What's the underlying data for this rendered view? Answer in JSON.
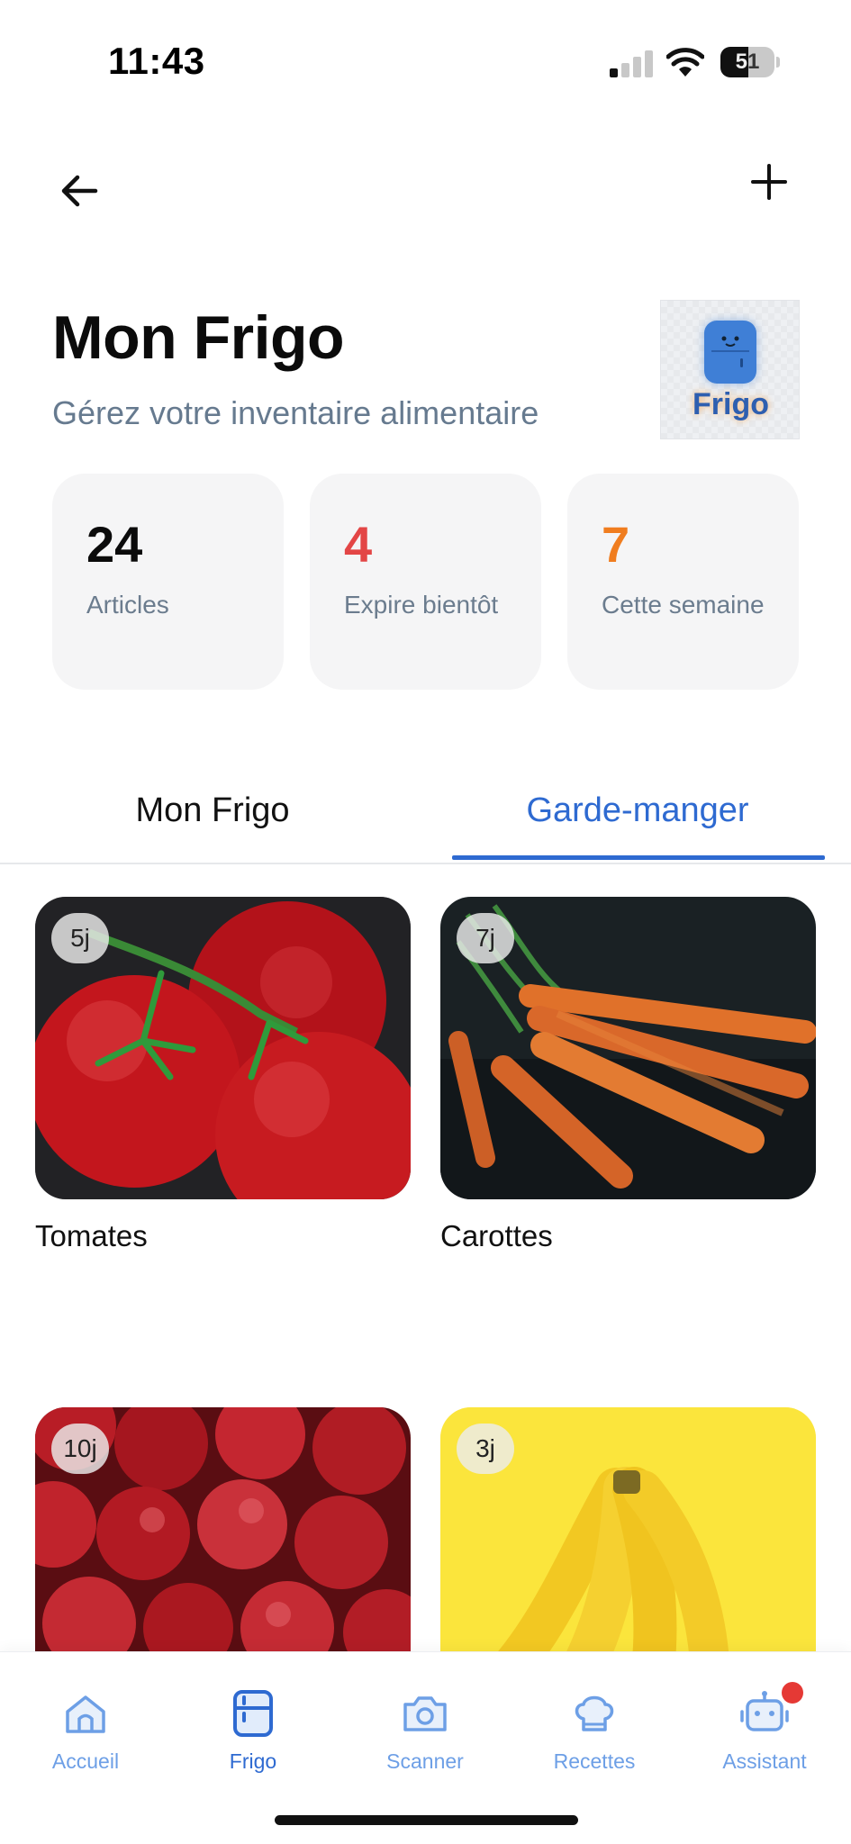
{
  "status_bar": {
    "time": "11:43",
    "battery": "51",
    "battery_level": 0.51,
    "signal_bars_active": 1,
    "signal_bars_total": 4
  },
  "header": {
    "back_icon": "arrow-left-icon",
    "add_icon": "plus-icon",
    "title": "Mon Frigo",
    "subtitle": "Gérez votre inventaire alimentaire",
    "logo_text": "Frigo"
  },
  "stats": [
    {
      "value": "24",
      "label": "Articles",
      "color": "#0b0b0b"
    },
    {
      "value": "4",
      "label": "Expire bientôt",
      "color": "#e34646"
    },
    {
      "value": "7",
      "label": "Cette semaine",
      "color": "#f07d1f"
    }
  ],
  "tabs": [
    {
      "label": "Mon Frigo",
      "active": false
    },
    {
      "label": "Garde-manger",
      "active": true
    }
  ],
  "products": [
    {
      "name": "Tomates",
      "days": "5j",
      "image": "tomatoes-photo"
    },
    {
      "name": "Carottes",
      "days": "7j",
      "image": "carrots-photo"
    },
    {
      "name": "",
      "days": "10j",
      "image": "apples-photo"
    },
    {
      "name": "",
      "days": "3j",
      "image": "bananas-photo"
    }
  ],
  "nav": [
    {
      "label": "Accueil",
      "icon": "home-icon",
      "active": false
    },
    {
      "label": "Frigo",
      "icon": "fridge-icon",
      "active": true
    },
    {
      "label": "Scanner",
      "icon": "camera-icon",
      "active": false
    },
    {
      "label": "Recettes",
      "icon": "chef-hat-icon",
      "active": false
    },
    {
      "label": "Assistant",
      "icon": "robot-icon",
      "active": false,
      "has_notification": true
    }
  ],
  "colors": {
    "accent": "#2e6ad1",
    "nav_inactive": "#6d9fe6",
    "subtitle": "#667a8f",
    "warning_red": "#e34646",
    "warning_orange": "#f07d1f",
    "notification": "#e53935"
  }
}
